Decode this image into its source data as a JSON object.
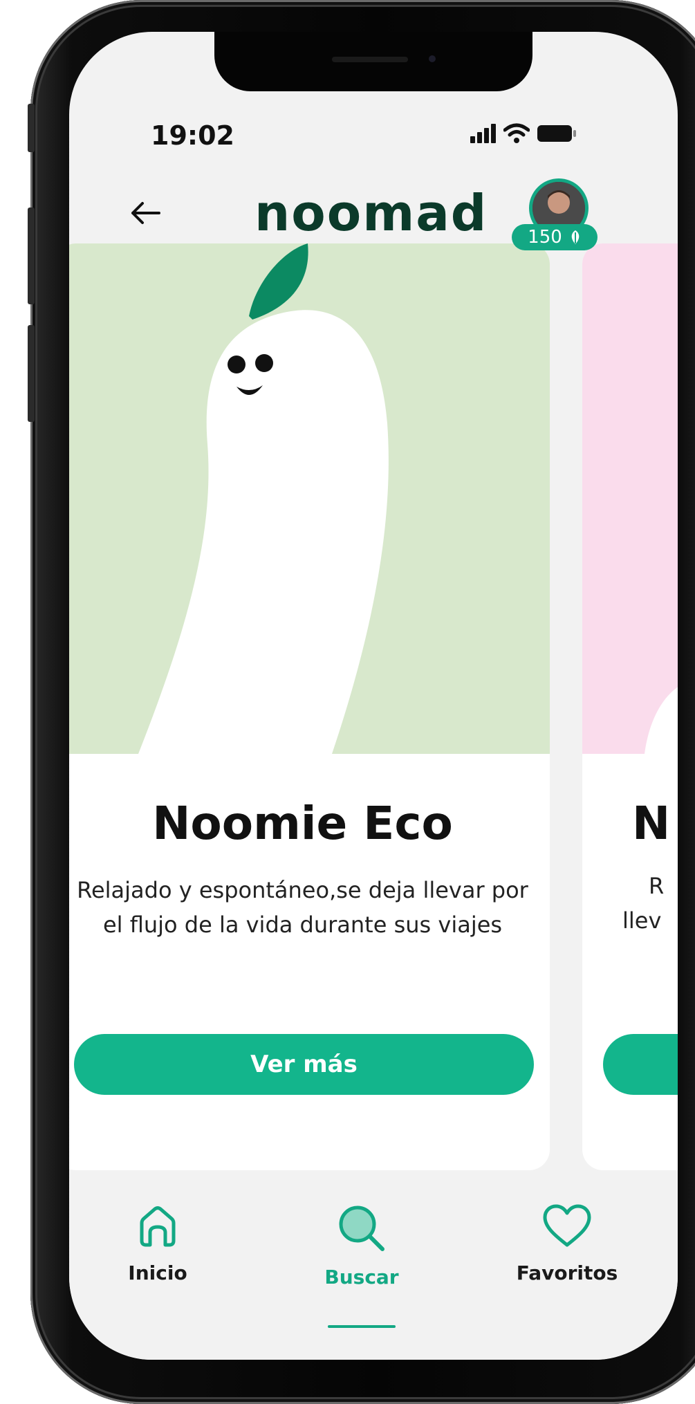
{
  "status": {
    "time": "19:02"
  },
  "header": {
    "logo": "noomad",
    "points": "150"
  },
  "cards": [
    {
      "title": "Noomie Eco",
      "description": "Relajado y espontáneo,se deja llevar por el flujo de la vida durante sus viajes",
      "button_label": "Ver más",
      "bg_color": "#d8e8cc"
    },
    {
      "title_partial": "N",
      "desc_partial_1": "R",
      "desc_partial_2": "llev",
      "bg_color": "#fadcec"
    }
  ],
  "nav": {
    "items": [
      {
        "label": "Inicio",
        "icon": "home-icon"
      },
      {
        "label": "Buscar",
        "icon": "search-icon",
        "active": true
      },
      {
        "label": "Favoritos",
        "icon": "heart-icon"
      }
    ]
  },
  "colors": {
    "accent": "#13b58c",
    "logo": "#0b3a2a"
  }
}
